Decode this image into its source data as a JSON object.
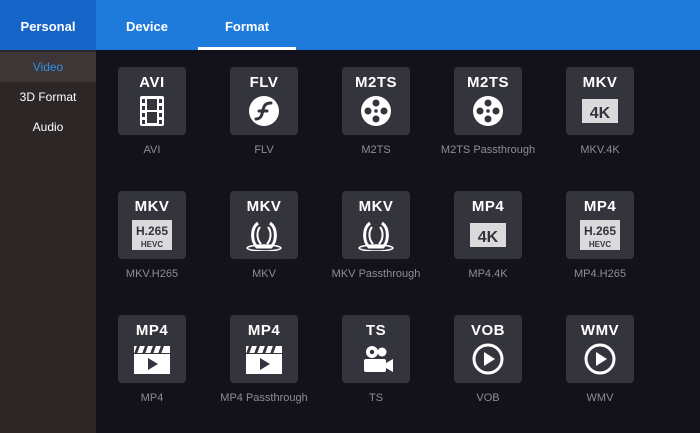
{
  "tabs": [
    {
      "label": "Personal"
    },
    {
      "label": "Device"
    },
    {
      "label": "Format"
    }
  ],
  "sidebar": {
    "items": [
      {
        "label": "Video",
        "active": true
      },
      {
        "label": "3D Format"
      },
      {
        "label": "Audio"
      }
    ]
  },
  "formats": [
    {
      "badge": "AVI",
      "icon": "film-strip-icon",
      "caption": "AVI"
    },
    {
      "badge": "FLV",
      "icon": "flash-icon",
      "caption": "FLV"
    },
    {
      "badge": "M2TS",
      "icon": "film-reel-icon",
      "caption": "M2TS"
    },
    {
      "badge": "M2TS",
      "icon": "film-reel-icon",
      "caption": "M2TS Passthrough"
    },
    {
      "badge": "MKV",
      "icon": "4k-badge-icon",
      "sub": "4K",
      "caption": "MKV.4K"
    },
    {
      "badge": "MKV",
      "icon": "h265-badge-icon",
      "sub": "H.265",
      "sub2": "HEVC",
      "caption": "MKV.H265"
    },
    {
      "badge": "MKV",
      "icon": "matroska-icon",
      "caption": "MKV"
    },
    {
      "badge": "MKV",
      "icon": "matroska-icon",
      "caption": "MKV Passthrough"
    },
    {
      "badge": "MP4",
      "icon": "4k-badge-icon",
      "sub": "4K",
      "caption": "MP4.4K"
    },
    {
      "badge": "MP4",
      "icon": "h265-badge-icon",
      "sub": "H.265",
      "sub2": "HEVC",
      "caption": "MP4.H265"
    },
    {
      "badge": "MP4",
      "icon": "clapper-play-icon",
      "caption": "MP4"
    },
    {
      "badge": "MP4",
      "icon": "clapper-play-icon",
      "caption": "MP4 Passthrough"
    },
    {
      "badge": "TS",
      "icon": "video-camera-icon",
      "caption": "TS"
    },
    {
      "badge": "VOB",
      "icon": "play-circle-icon",
      "caption": "VOB"
    },
    {
      "badge": "WMV",
      "icon": "play-circle-icon",
      "caption": "WMV"
    }
  ],
  "colors": {
    "header": "#1e7bdc",
    "active_text": "#2f8fe8",
    "sidebar": "#2d2627",
    "tile": "#34343c",
    "background": "#13121a"
  }
}
